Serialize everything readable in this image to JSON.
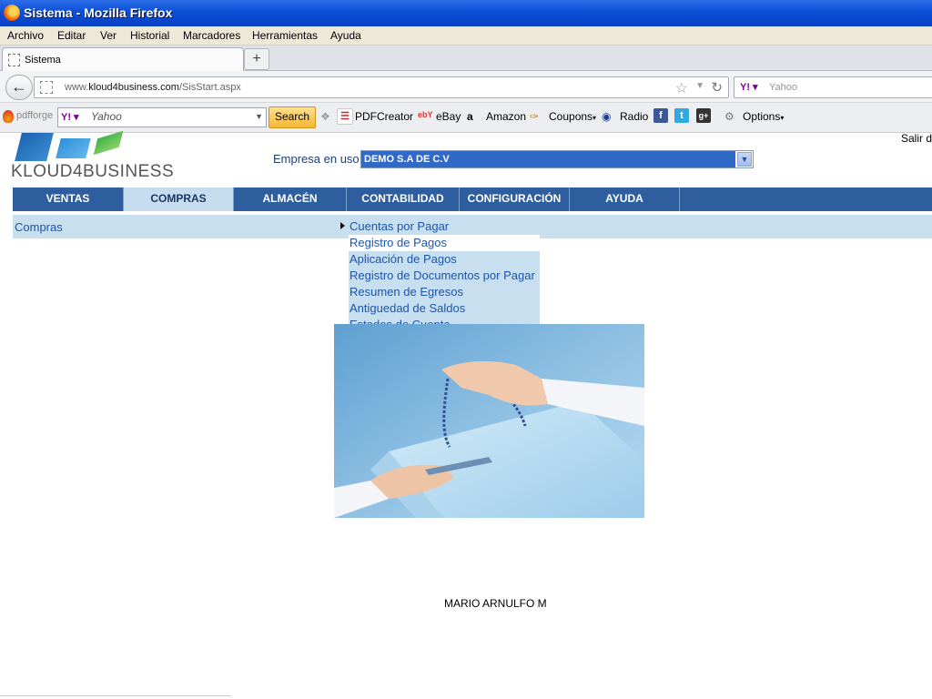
{
  "window": {
    "title": "Sistema - Mozilla Firefox"
  },
  "menubar": {
    "items": [
      "Archivo",
      "Editar",
      "Ver",
      "Historial",
      "Marcadores",
      "Herramientas",
      "Ayuda"
    ]
  },
  "tab": {
    "title": "Sistema",
    "new_tab": "+"
  },
  "nav": {
    "url_prefix": "www.",
    "url_domain": "kloud4business.com",
    "url_path": "/SisStart.aspx",
    "search_engine": "Yahoo",
    "search_logo": "Y!"
  },
  "toolbar": {
    "pdfforge": "pdfforge",
    "yahoo_logo": "Y!",
    "yahoo_placeholder": "Yahoo",
    "search_button": "Search",
    "pdfcreator": "PDFCreator",
    "ebay": "eBay",
    "amazon": "Amazon",
    "coupons": "Coupons",
    "radio": "Radio",
    "options": "Options"
  },
  "page": {
    "logo_text": "KLOUD4BUSINESS",
    "logout": "Salir d",
    "company_label": "Empresa en uso:",
    "company_value": "DEMO S.A DE C.V",
    "main_nav": [
      "VENTAS",
      "COMPRAS",
      "ALMACÉN",
      "CONTABILIDAD",
      "CONFIGURACIÓN",
      "AYUDA"
    ],
    "active_nav": "COMPRAS",
    "section": "Compras",
    "submenu": {
      "header": "Cuentas por Pagar",
      "items": [
        "Registro de Pagos",
        "Aplicación de Pagos",
        "Registro de Documentos por Pagar",
        "Resumen de Egresos",
        "Antiguedad de Saldos",
        "Estados de Cuenta"
      ]
    },
    "user": "MARIO ARNULFO M"
  },
  "colors": {
    "nav_bg": "#2e5e9e",
    "nav_active": "#c6dcef",
    "subbar_bg": "#c8dff0",
    "link": "#1d55a8",
    "select_highlight": "#3169c6"
  }
}
